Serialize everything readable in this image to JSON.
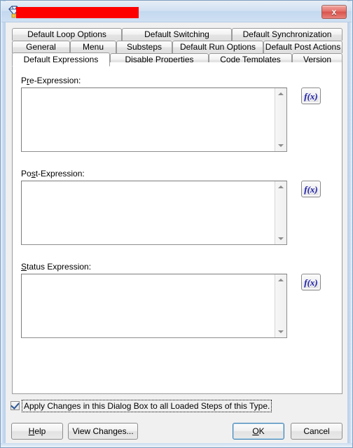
{
  "window": {
    "title_redacted": true,
    "icon": "gem-icon",
    "close_label": "x",
    "accent": "#3c7fb1",
    "redaction_color": "#fe0000"
  },
  "tabs": {
    "row1": [
      {
        "label": "Default Loop Options",
        "selected": false
      },
      {
        "label": "Default Switching",
        "selected": false
      },
      {
        "label": "Default Synchronization",
        "selected": false
      }
    ],
    "row2": [
      {
        "label": "General",
        "selected": false
      },
      {
        "label": "Menu",
        "selected": false
      },
      {
        "label": "Substeps",
        "selected": false
      },
      {
        "label": "Default Run Options",
        "selected": false
      },
      {
        "label": "Default Post Actions",
        "selected": false
      }
    ],
    "row3": [
      {
        "label": "Default Expressions",
        "selected": true
      },
      {
        "label": "Disable Properties",
        "selected": false
      },
      {
        "label": "Code Templates",
        "selected": false
      },
      {
        "label": "Version",
        "selected": false
      }
    ]
  },
  "fields": {
    "pre": {
      "label_pre": "P",
      "label_accel": "r",
      "label_post": "e-Expression:",
      "value": "",
      "placeholder": "",
      "fx_label": "f(x)"
    },
    "post": {
      "label_pre": "Po",
      "label_accel": "s",
      "label_post": "t-Expression:",
      "value": "",
      "placeholder": "",
      "fx_label": "f(x)"
    },
    "status": {
      "label_pre": "",
      "label_accel": "S",
      "label_post": "tatus Expression:",
      "value": "",
      "placeholder": "",
      "fx_label": "f(x)"
    }
  },
  "apply": {
    "checked": true,
    "label": "Apply Changes in this Dialog Box to all Loaded Steps of this Type."
  },
  "buttons": {
    "help_pre": "",
    "help_accel": "H",
    "help_post": "elp",
    "view_changes_pre": "View Chan",
    "view_changes_accel": "g",
    "view_changes_post": "es...",
    "ok_pre": "",
    "ok_accel": "O",
    "ok_post": "K",
    "cancel": "Cancel"
  }
}
